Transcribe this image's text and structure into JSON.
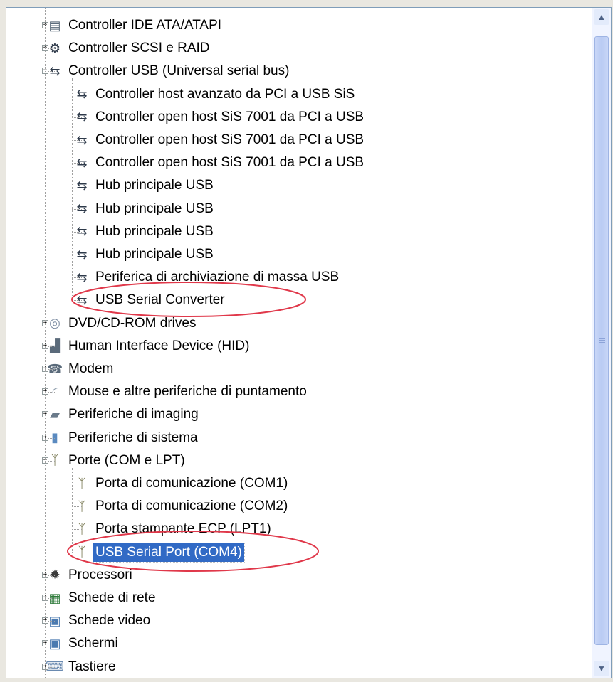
{
  "tree": {
    "items": [
      {
        "label": "Controller IDE ATA/ATAPI",
        "icon": "ide-controller-icon",
        "glyph": "▤",
        "color": "#5a6a7a",
        "level": 0,
        "expander": "+"
      },
      {
        "label": "Controller SCSI e RAID",
        "icon": "scsi-controller-icon",
        "glyph": "⚙",
        "color": "#2e3a4a",
        "level": 0,
        "expander": "+"
      },
      {
        "label": "Controller USB (Universal serial bus)",
        "icon": "usb-icon",
        "glyph": "⇆",
        "color": "#2e3a4a",
        "level": 0,
        "expander": "−"
      },
      {
        "label": "Controller host avanzato da PCI a USB SiS",
        "icon": "usb-icon",
        "glyph": "⇆",
        "color": "#2e3a4a",
        "level": 1
      },
      {
        "label": "Controller open host SiS 7001 da PCI a USB",
        "icon": "usb-icon",
        "glyph": "⇆",
        "color": "#2e3a4a",
        "level": 1
      },
      {
        "label": "Controller open host SiS 7001 da PCI a USB",
        "icon": "usb-icon",
        "glyph": "⇆",
        "color": "#2e3a4a",
        "level": 1
      },
      {
        "label": "Controller open host SiS 7001 da PCI a USB",
        "icon": "usb-icon",
        "glyph": "⇆",
        "color": "#2e3a4a",
        "level": 1
      },
      {
        "label": "Hub principale USB",
        "icon": "usb-icon",
        "glyph": "⇆",
        "color": "#2e3a4a",
        "level": 1
      },
      {
        "label": "Hub principale USB",
        "icon": "usb-icon",
        "glyph": "⇆",
        "color": "#2e3a4a",
        "level": 1
      },
      {
        "label": "Hub principale USB",
        "icon": "usb-icon",
        "glyph": "⇆",
        "color": "#2e3a4a",
        "level": 1
      },
      {
        "label": "Hub principale USB",
        "icon": "usb-icon",
        "glyph": "⇆",
        "color": "#2e3a4a",
        "level": 1
      },
      {
        "label": "Periferica di archiviazione di massa USB",
        "icon": "usb-icon",
        "glyph": "⇆",
        "color": "#2e3a4a",
        "level": 1
      },
      {
        "label": "USB Serial Converter",
        "icon": "usb-icon",
        "glyph": "⇆",
        "color": "#2e3a4a",
        "level": 1
      },
      {
        "label": "DVD/CD-ROM drives",
        "icon": "cdrom-icon",
        "glyph": "◎",
        "color": "#7a8aa0",
        "level": 0,
        "expander": "+"
      },
      {
        "label": "Human Interface Device (HID)",
        "icon": "hid-icon",
        "glyph": "▟",
        "color": "#5a6a7a",
        "level": 0,
        "expander": "+"
      },
      {
        "label": "Modem",
        "icon": "modem-icon",
        "glyph": "☎",
        "color": "#5a6a7a",
        "level": 0,
        "expander": "+"
      },
      {
        "label": "Mouse e altre periferiche di puntamento",
        "icon": "mouse-icon",
        "glyph": "◜",
        "color": "#8a9aaa",
        "level": 0,
        "expander": "+"
      },
      {
        "label": "Periferiche di imaging",
        "icon": "imaging-icon",
        "glyph": "▰",
        "color": "#6a7a8a",
        "level": 0,
        "expander": "+"
      },
      {
        "label": "Periferiche di sistema",
        "icon": "system-device-icon",
        "glyph": "▮",
        "color": "#5a8ac0",
        "level": 0,
        "expander": "+"
      },
      {
        "label": "Porte (COM e LPT)",
        "icon": "port-icon",
        "glyph": "ᛉ",
        "color": "#6a6a40",
        "level": 0,
        "expander": "−"
      },
      {
        "label": "Porta di comunicazione (COM1)",
        "icon": "port-icon",
        "glyph": "ᛉ",
        "color": "#6a6a40",
        "level": 1
      },
      {
        "label": "Porta di comunicazione (COM2)",
        "icon": "port-icon",
        "glyph": "ᛉ",
        "color": "#6a6a40",
        "level": 1
      },
      {
        "label": "Porta stampante ECP (LPT1)",
        "icon": "port-icon",
        "glyph": "ᛉ",
        "color": "#6a6a40",
        "level": 1
      },
      {
        "label": "USB Serial Port (COM4)",
        "icon": "port-icon",
        "glyph": "ᛉ",
        "color": "#6a6a40",
        "level": 1,
        "selected": true
      },
      {
        "label": "Processori",
        "icon": "processor-icon",
        "glyph": "✹",
        "color": "#3a3a3a",
        "level": 0,
        "expander": "+"
      },
      {
        "label": "Schede di rete",
        "icon": "network-card-icon",
        "glyph": "▦",
        "color": "#2e7a3a",
        "level": 0,
        "expander": "+"
      },
      {
        "label": "Schede video",
        "icon": "display-adapter-icon",
        "glyph": "▣",
        "color": "#4a7ab0",
        "level": 0,
        "expander": "+"
      },
      {
        "label": "Schermi",
        "icon": "monitor-icon",
        "glyph": "▣",
        "color": "#4a7ab0",
        "level": 0,
        "expander": "+"
      },
      {
        "label": "Tastiere",
        "icon": "keyboard-icon",
        "glyph": "⌨",
        "color": "#6a8ab0",
        "level": 0,
        "expander": "+"
      }
    ]
  },
  "scrollbar": {
    "up_arrow": "▲",
    "down_arrow": "▼"
  },
  "colors": {
    "selection": "#316ac5",
    "annotation": "#e0384a",
    "border": "#7f9db9"
  }
}
